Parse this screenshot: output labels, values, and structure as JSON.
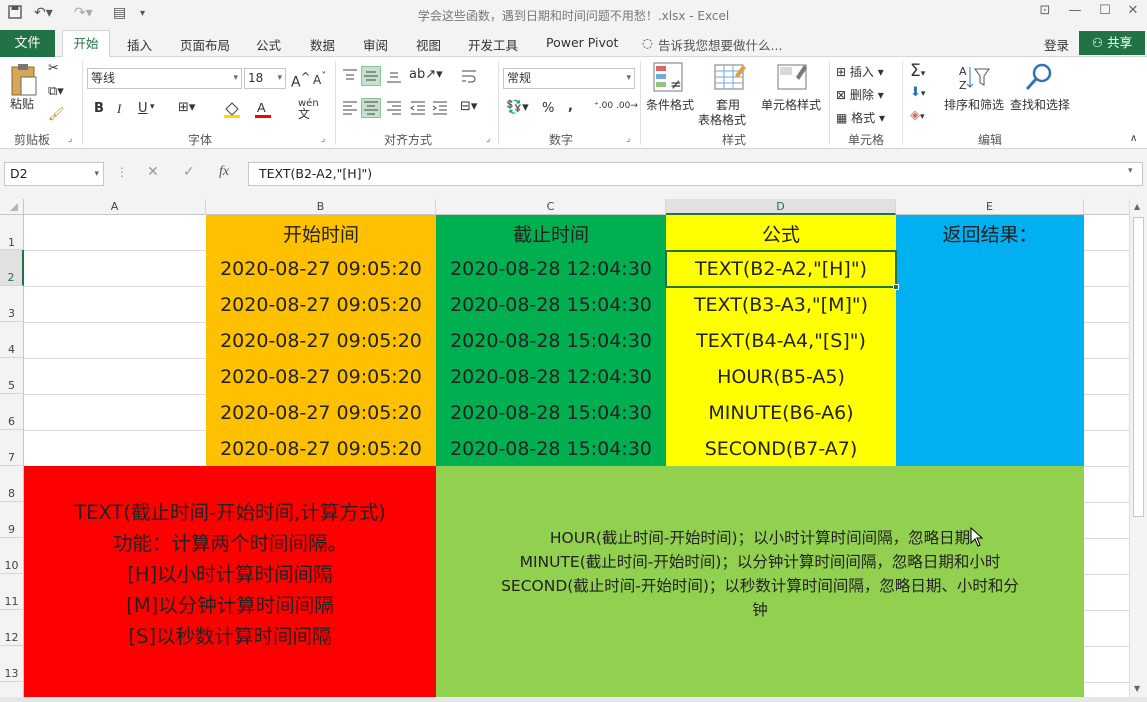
{
  "title": "学会这些函数，遇到日期和时间问题不用愁！.xlsx - Excel",
  "file_tab": "文件",
  "tabs": [
    "开始",
    "插入",
    "页面布局",
    "公式",
    "数据",
    "审阅",
    "视图",
    "开发工具",
    "Power Pivot"
  ],
  "tell_me": "告诉我您想要做什么...",
  "login": "登录",
  "share": "共享",
  "ribbon": {
    "paste": "粘贴",
    "groups": [
      "剪贴板",
      "字体",
      "对齐方式",
      "数字",
      "样式",
      "单元格",
      "编辑"
    ],
    "font_name": "等线",
    "font_size": "18",
    "number_format": "常规",
    "conditional_format": "条件格式",
    "table_format_1": "套用",
    "table_format_2": "表格格式",
    "cell_style": "单元格样式",
    "insert": "插入",
    "delete": "删除",
    "format": "格式",
    "sort_filter": "排序和筛选",
    "find_select": "查找和选择",
    "bold": "B",
    "italic": "I",
    "underline": "U",
    "font_grow": "A",
    "font_shrink": "A",
    "percent": "%",
    "comma": ",",
    "wen": "wén",
    "wen_char": "文"
  },
  "name_box": "D2",
  "formula": "TEXT(B2-A2,\"[H]\")",
  "fx": "fx",
  "columns": [
    "A",
    "B",
    "C",
    "D",
    "E"
  ],
  "rows": [
    "1",
    "2",
    "3",
    "4",
    "5",
    "6",
    "7",
    "8",
    "9",
    "10",
    "11",
    "12",
    "13"
  ],
  "headers": {
    "b": "开始时间",
    "c": "截止时间",
    "d": "公式",
    "e": "返回结果："
  },
  "data_rows": [
    {
      "start": "2020-08-27 09:05:20",
      "end": "2020-08-28 12:04:30",
      "formula": "TEXT(B2-A2,\"[H]\")"
    },
    {
      "start": "2020-08-27 09:05:20",
      "end": "2020-08-28 15:04:30",
      "formula": "TEXT(B3-A3,\"[M]\")"
    },
    {
      "start": "2020-08-27 09:05:20",
      "end": "2020-08-28 15:04:30",
      "formula": "TEXT(B4-A4,\"[S]\")"
    },
    {
      "start": "2020-08-27 09:05:20",
      "end": "2020-08-28 12:04:30",
      "formula": "HOUR(B5-A5)"
    },
    {
      "start": "2020-08-27 09:05:20",
      "end": "2020-08-28 15:04:30",
      "formula": "MINUTE(B6-A6)"
    },
    {
      "start": "2020-08-27 09:05:20",
      "end": "2020-08-28 15:04:30",
      "formula": "SECOND(B7-A7)"
    }
  ],
  "note_red": [
    "TEXT(截止时间-开始时间,计算方式)",
    "功能：计算两个时间间隔。",
    "[H]以小时计算时间间隔",
    "[M]以分钟计算时间间隔",
    "[S]以秒数计算时间间隔"
  ],
  "note_green": [
    "HOUR(截止时间-开始时间)；以小时计算时间间隔，忽略日期",
    "MINUTE(截止时间-开始时间)；以分钟计算时间间隔，忽略日期和小时",
    "SECOND(截止时间-开始时间)；以秒数计算时间间隔，忽略日期、小时和分",
    "钟"
  ],
  "colors": {
    "orange": "#FFC000",
    "green": "#00B050",
    "yellow": "#FFFF00",
    "blue": "#00B0F0",
    "red": "#FF0000",
    "lightgreen": "#92D050",
    "excel": "#217346"
  }
}
